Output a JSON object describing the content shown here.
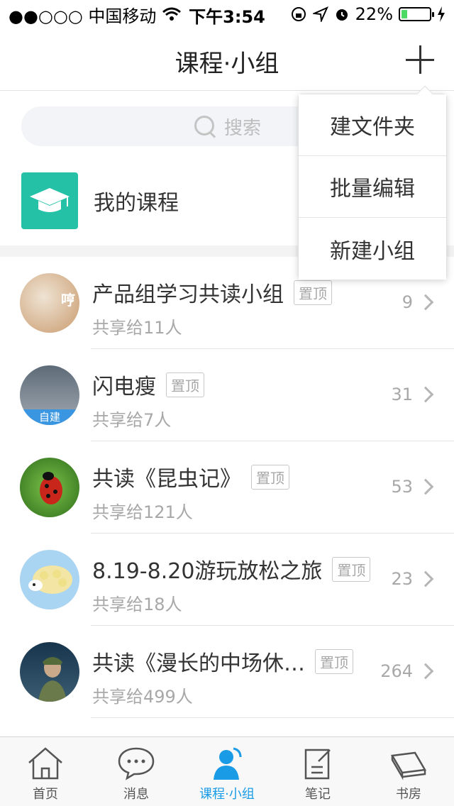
{
  "status_bar": {
    "carrier": "●●○○○ 中国移动",
    "time": "下午3:54",
    "battery": "22%",
    "battery_level": 0.22,
    "battery_color": "#4cd964"
  },
  "nav": {
    "title": "课程·小组",
    "add_icon": "plus-icon"
  },
  "search": {
    "placeholder": "搜索"
  },
  "my_course": {
    "label": "我的课程",
    "icon": "graduation-cap-icon",
    "icon_color": "#24c1a7"
  },
  "dropdown": {
    "items": [
      "建文件夹",
      "批量编辑",
      "新建小组"
    ]
  },
  "groups": [
    {
      "title": "产品组学习共读小组",
      "tag": "置顶",
      "subtitle": "共享给11人",
      "count": "9",
      "avatar_overlay": "哼",
      "avatar_color": "#d9b48f"
    },
    {
      "title": "闪电瘦",
      "tag": "置顶",
      "subtitle": "共享给7人",
      "count": "31",
      "avatar_badge": "自建",
      "avatar_color": "#7a8a9a"
    },
    {
      "title": "共读《昆虫记》",
      "tag": "置顶",
      "subtitle": "共享给121人",
      "count": "53",
      "avatar_color": "#3f8f2a"
    },
    {
      "title": "8.19-8.20游玩放松之旅",
      "tag": "置顶",
      "subtitle": "共享给18人",
      "count": "23",
      "avatar_color": "#a9d4f2"
    },
    {
      "title": "共读《漫长的中场休…",
      "tag": "置顶",
      "subtitle": "共享给499人",
      "count": "264",
      "avatar_color": "#1e3a55"
    }
  ],
  "tabs": [
    {
      "label": "首页",
      "icon": "home-icon",
      "active": false
    },
    {
      "label": "消息",
      "icon": "chat-bubble-icon",
      "active": false
    },
    {
      "label": "课程·小组",
      "icon": "person-icon",
      "active": true
    },
    {
      "label": "笔记",
      "icon": "note-edit-icon",
      "active": false
    },
    {
      "label": "书房",
      "icon": "book-icon",
      "active": false
    }
  ],
  "accent_color": "#1a9be6"
}
